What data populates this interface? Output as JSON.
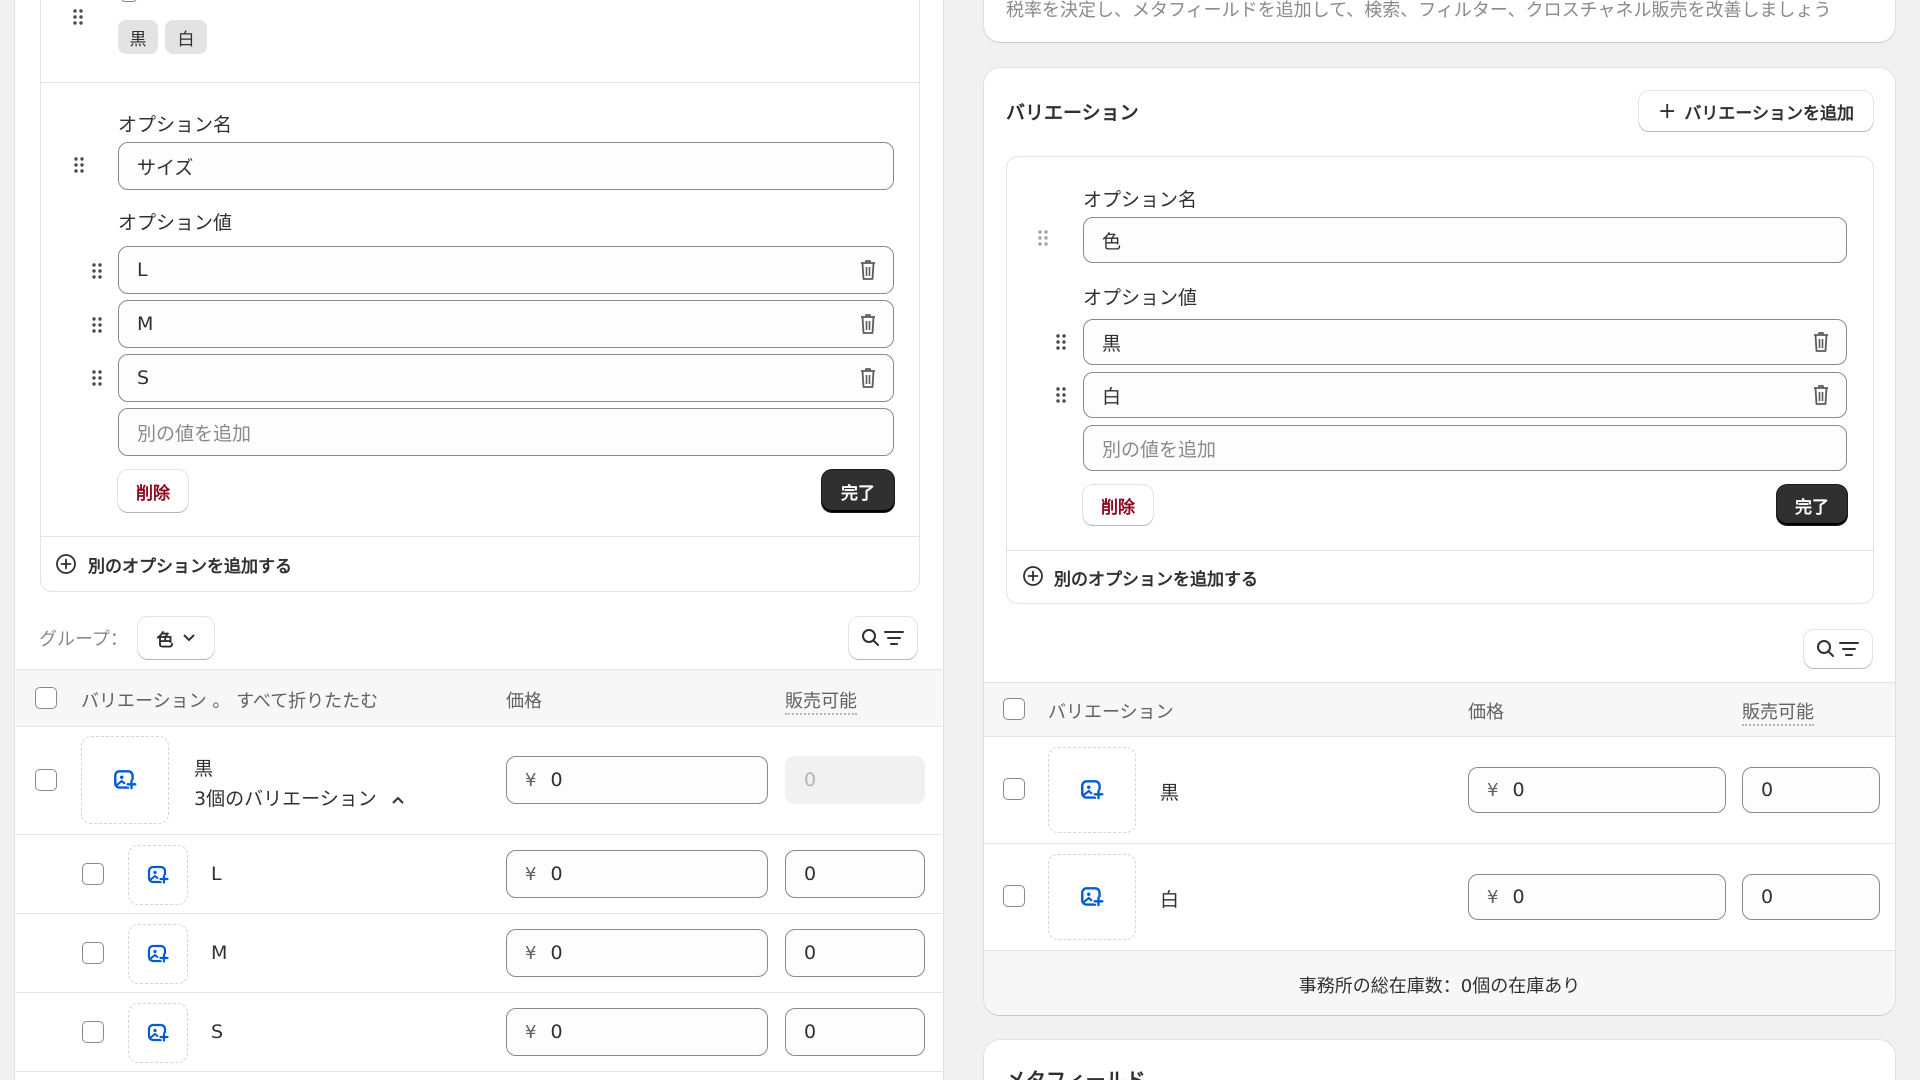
{
  "colors": {
    "accent": "#005bd3",
    "danger": "#8e0b21",
    "dark_button": "#303030"
  },
  "left_panel": {
    "option1_values_chips": [
      "黒",
      "白"
    ],
    "option2": {
      "name_label": "オプション名",
      "name_value": "サイズ",
      "values_label": "オプション値",
      "values": [
        "L",
        "M",
        "S"
      ],
      "add_placeholder": "別の値を追加",
      "delete_label": "削除",
      "done_label": "完了"
    },
    "add_option_label": "別のオプションを追加する",
    "group_label": "グループ：",
    "group_value": "色",
    "table": {
      "header_variant": "バリエーション 。 すべて折りたたむ",
      "header_price": "価格",
      "header_available": "販売可能",
      "group_row": {
        "name": "黒",
        "sub": "3個のバリエーション",
        "price": "0",
        "available": "0",
        "currency": "¥"
      },
      "rows": [
        {
          "name": "L",
          "price": "0",
          "available": "0",
          "currency": "¥"
        },
        {
          "name": "M",
          "price": "0",
          "available": "0",
          "currency": "¥"
        },
        {
          "name": "S",
          "price": "0",
          "available": "0",
          "currency": "¥"
        }
      ]
    }
  },
  "right_panel": {
    "top_card_text": "税率を決定し、メタフィールドを追加して、検索、フィルター、クロスチャネル販売を改善しましょう",
    "variants_title": "バリエーション",
    "add_variant_button": "バリエーションを追加",
    "option1": {
      "name_label": "オプション名",
      "name_value": "色",
      "values_label": "オプション値",
      "values": [
        "黒",
        "白"
      ],
      "add_placeholder": "別の値を追加",
      "delete_label": "削除",
      "done_label": "完了"
    },
    "add_option_label": "別のオプションを追加する",
    "table": {
      "header_variant": "バリエーション",
      "header_price": "価格",
      "header_available": "販売可能",
      "rows": [
        {
          "name": "黒",
          "price": "0",
          "available": "0",
          "currency": "¥"
        },
        {
          "name": "白",
          "price": "0",
          "available": "0",
          "currency": "¥"
        }
      ]
    },
    "total_inventory": "事務所の総在庫数：0個の在庫あり",
    "metafields_title": "メタフィールド"
  }
}
